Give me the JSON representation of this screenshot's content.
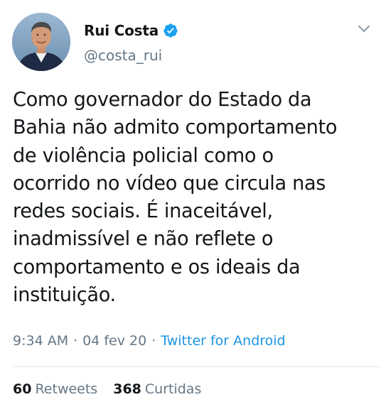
{
  "author": {
    "display_name": "Rui Costa",
    "handle": "@costa_rui",
    "verified": true,
    "avatar_icon": "profile-photo"
  },
  "tweet": {
    "text": "Como governador do Estado da\nBahia não admito comportamento\nde violência policial como o\nocorrido no vídeo que circula nas\nredes sociais. É inaceitável,\ninadmissível e não reflete o\ncomportamento e os ideais da\ninstituição.",
    "time": "9:34 AM",
    "date": "04 fev 20",
    "source": "Twitter for Android",
    "separator": "·"
  },
  "stats": {
    "retweets_count": "60",
    "retweets_label": "Retweets",
    "likes_count": "368",
    "likes_label": "Curtidas"
  },
  "colors": {
    "text": "#14171a",
    "secondary": "#657786",
    "link": "#1b95e0",
    "verified": "#1da1f2",
    "divider": "#e1e8ed"
  }
}
